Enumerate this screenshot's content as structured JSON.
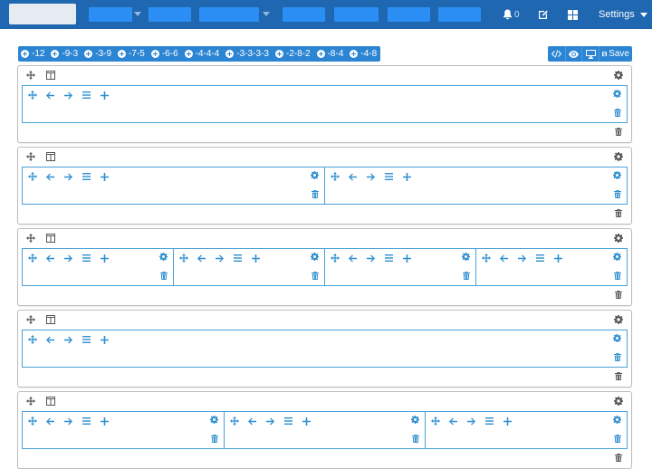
{
  "nav": {
    "bell_count": "0",
    "settings_label": "Settings"
  },
  "toolbar": {
    "presets": [
      "-12",
      "-9-3",
      "-3-9",
      "-7-5",
      "-6-6",
      "-4-4-4",
      "-3-3-3-3",
      "-2-8-2",
      "-8-4",
      "-4-8"
    ],
    "save_label": "Save"
  },
  "icons": {
    "col_tools": [
      "move-icon",
      "arrow-left-icon",
      "arrow-right-icon",
      "list-icon",
      "plus-icon"
    ],
    "col_side": [
      "gear-icon",
      "trash-icon"
    ],
    "row_ctrl": [
      "move-icon",
      "columns-icon",
      "gear-icon",
      "trash-icon"
    ]
  },
  "colors": {
    "navbar": "#1f67b1",
    "accent": "#2c85d3",
    "column_border": "#4aa1d8"
  },
  "rows": [
    {
      "columns": 1
    },
    {
      "columns": 2
    },
    {
      "columns": 4
    },
    {
      "columns": 1
    },
    {
      "columns": 3
    }
  ]
}
